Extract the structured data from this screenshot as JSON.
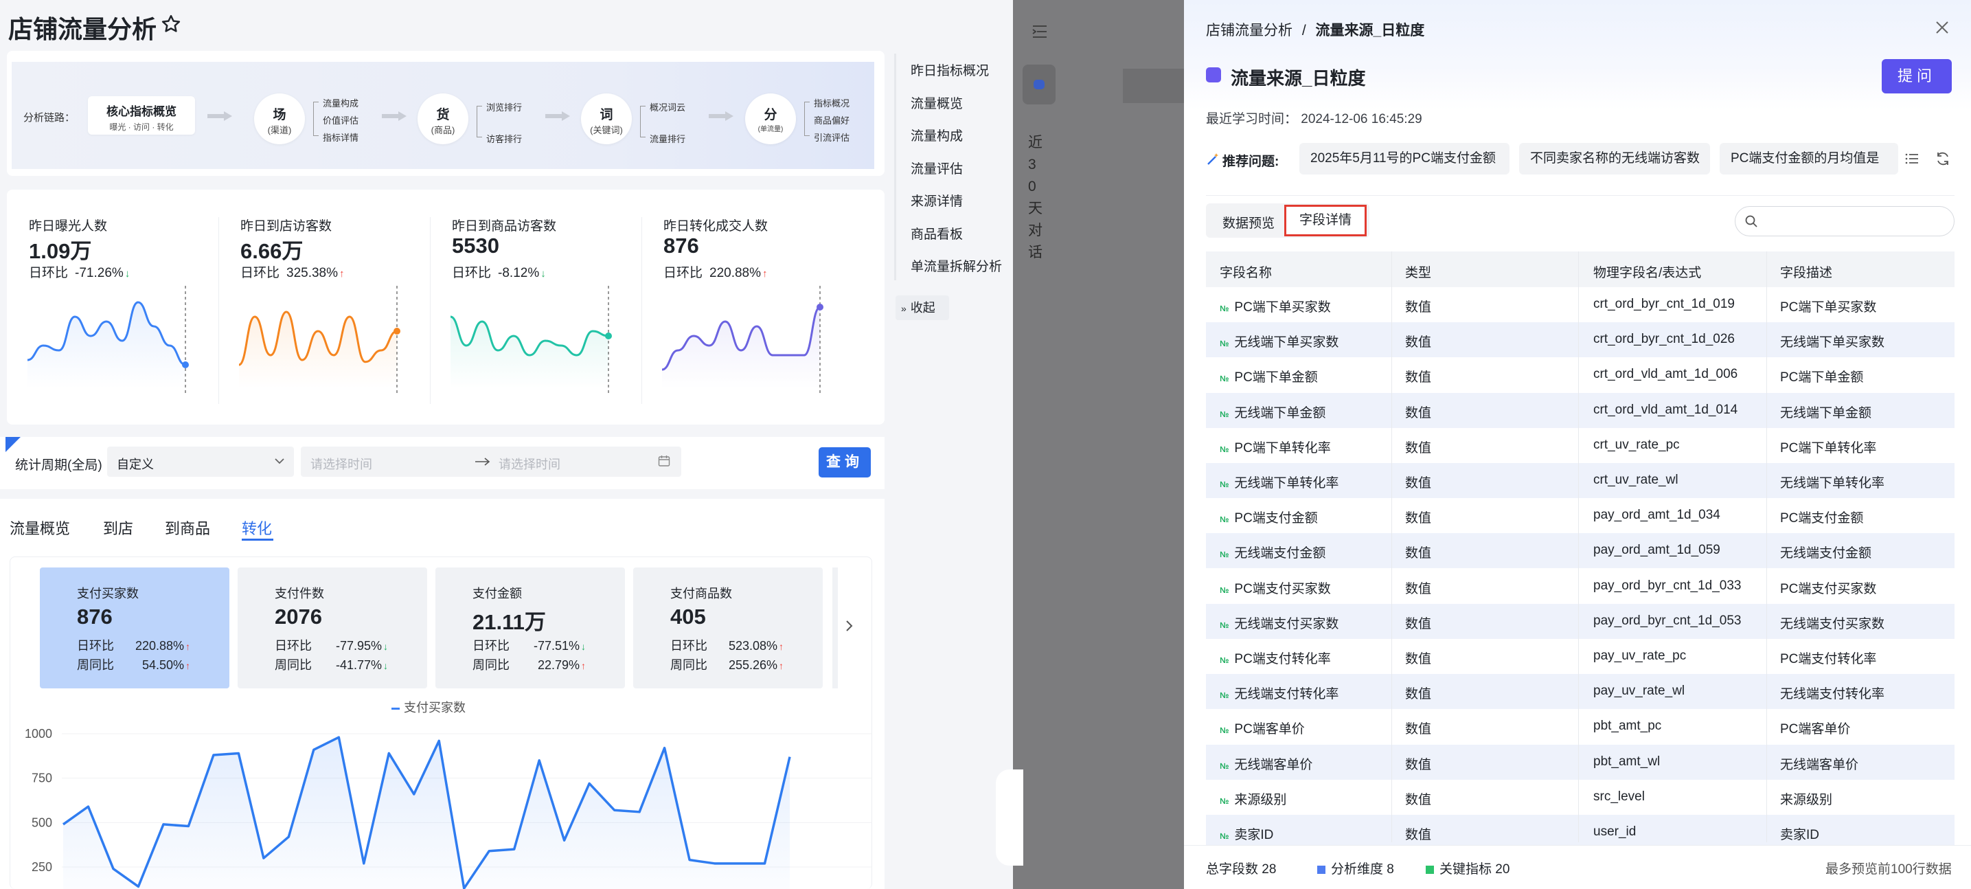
{
  "page": {
    "title": "店铺流量分析",
    "star_icon": "star-outline-icon"
  },
  "chain": {
    "label": "分析链路：",
    "core": {
      "title": "核心指标概览",
      "sub": "曝光 · 访问 · 转化"
    },
    "nodes": [
      {
        "big": "场",
        "small": "(渠道)",
        "subs": [
          "流量构成",
          "价值评估",
          "指标详情"
        ]
      },
      {
        "big": "货",
        "small": "(商品)",
        "subs": [
          "浏览排行",
          "访客排行"
        ]
      },
      {
        "big": "词",
        "small": "(关键词)",
        "subs": [
          "概况词云",
          "流量排行"
        ]
      },
      {
        "big": "分",
        "small": "(单流量)",
        "subs": [
          "指标概况",
          "商品偏好",
          "引流评估"
        ]
      }
    ]
  },
  "metrics": [
    {
      "title": "昨日曝光人数",
      "value": "1.09万",
      "cmp_label": "日环比",
      "cmp": "-71.26%",
      "dir": "down",
      "color": "#3b82f6",
      "series": [
        0.3,
        0.45,
        0.4,
        0.75,
        0.55,
        0.7,
        0.5,
        0.9,
        0.65,
        0.45,
        0.25
      ]
    },
    {
      "title": "昨日到店访客数",
      "value": "6.66万",
      "cmp_label": "日环比",
      "cmp": "325.38%",
      "dir": "up",
      "color": "#f5851f",
      "series": [
        0.25,
        0.75,
        0.35,
        0.8,
        0.3,
        0.6,
        0.35,
        0.75,
        0.28,
        0.4,
        0.6
      ]
    },
    {
      "title": "昨日到商品访客数",
      "value": "5530",
      "cmp_label": "日环比",
      "cmp": "-8.12%",
      "dir": "down",
      "color": "#22c3a6",
      "series": [
        0.75,
        0.45,
        0.7,
        0.4,
        0.55,
        0.35,
        0.5,
        0.45,
        0.35,
        0.6,
        0.55
      ]
    },
    {
      "title": "昨日转化成交人数",
      "value": "876",
      "cmp_label": "日环比",
      "cmp": "220.88%",
      "dir": "up",
      "color": "#6b63e0",
      "series": [
        0.2,
        0.4,
        0.55,
        0.45,
        0.7,
        0.4,
        0.65,
        0.35,
        0.35,
        0.35,
        0.85
      ]
    }
  ],
  "filter": {
    "label": "统计周期(全局)",
    "select_value": "自定义",
    "start_placeholder": "请选择时间",
    "end_placeholder": "请选择时间",
    "query_label": "查询"
  },
  "tabs": [
    "流量概览",
    "到店",
    "到商品",
    "转化"
  ],
  "active_tab": 3,
  "kpis": [
    {
      "title": "支付买家数",
      "value": "876",
      "d_label": "日环比",
      "d": "220.88%",
      "d_dir": "up",
      "w_label": "周同比",
      "w": "54.50%",
      "w_dir": "up"
    },
    {
      "title": "支付件数",
      "value": "2076",
      "d_label": "日环比",
      "d": "-77.95%",
      "d_dir": "down",
      "w_label": "周同比",
      "w": "-41.77%",
      "w_dir": "down"
    },
    {
      "title": "支付金额",
      "value": "21.11万",
      "d_label": "日环比",
      "d": "-77.51%",
      "d_dir": "down",
      "w_label": "周同比",
      "w": "22.79%",
      "w_dir": "up"
    },
    {
      "title": "支付商品数",
      "value": "405",
      "d_label": "日环比",
      "d": "523.08%",
      "d_dir": "up",
      "w_label": "周同比",
      "w": "255.26%",
      "w_dir": "up"
    }
  ],
  "chart_data": {
    "type": "area",
    "legend": "支付买家数",
    "y_ticks": [
      "1000",
      "750",
      "500",
      "250"
    ],
    "ylim": [
      130,
      1000
    ],
    "series": [
      {
        "name": "支付买家数",
        "values": [
          490,
          590,
          240,
          140,
          490,
          480,
          880,
          890,
          300,
          420,
          910,
          980,
          270,
          890,
          660,
          960,
          130,
          340,
          350,
          850,
          400,
          720,
          570,
          560,
          920,
          290,
          270,
          270,
          270,
          870
        ]
      }
    ]
  },
  "sidenav": {
    "items": [
      "昨日指标概况",
      "流量概览",
      "流量构成",
      "流量评估",
      "来源详情",
      "商品看板",
      "单流量拆解分析"
    ],
    "collapse_label": "收起"
  },
  "overlay": {
    "vertical_text": "近30天对话"
  },
  "drawer": {
    "breadcrumb_parent": "店铺流量分析",
    "breadcrumb_sep": "/",
    "breadcrumb_current": "流量来源_日粒度",
    "title": "流量来源_日粒度",
    "ask_label": "提问",
    "learn_time": "最近学习时间：   2024-12-06 16:45:29",
    "rec_label": "推荐问题:",
    "chips": [
      "2025年5月11号的PC端支付金额",
      "不同卖家名称的无线端访客数",
      "PC端支付金额的月均值是"
    ],
    "seg": [
      "数据预览",
      "字段详情"
    ],
    "columns": [
      "字段名称",
      "类型",
      "物理字段名/表达式",
      "字段描述"
    ],
    "rows": [
      [
        "PC端下单买家数",
        "数值",
        "crt_ord_byr_cnt_1d_019",
        "PC端下单买家数"
      ],
      [
        "无线端下单买家数",
        "数值",
        "crt_ord_byr_cnt_1d_026",
        "无线端下单买家数"
      ],
      [
        "PC端下单金额",
        "数值",
        "crt_ord_vld_amt_1d_006",
        "PC端下单金额"
      ],
      [
        "无线端下单金额",
        "数值",
        "crt_ord_vld_amt_1d_014",
        "无线端下单金额"
      ],
      [
        "PC端下单转化率",
        "数值",
        "crt_uv_rate_pc",
        "PC端下单转化率"
      ],
      [
        "无线端下单转化率",
        "数值",
        "crt_uv_rate_wl",
        "无线端下单转化率"
      ],
      [
        "PC端支付金额",
        "数值",
        "pay_ord_amt_1d_034",
        "PC端支付金额"
      ],
      [
        "无线端支付金额",
        "数值",
        "pay_ord_amt_1d_059",
        "无线端支付金额"
      ],
      [
        "PC端支付买家数",
        "数值",
        "pay_ord_byr_cnt_1d_033",
        "PC端支付买家数"
      ],
      [
        "无线端支付买家数",
        "数值",
        "pay_ord_byr_cnt_1d_053",
        "无线端支付买家数"
      ],
      [
        "PC端支付转化率",
        "数值",
        "pay_uv_rate_pc",
        "PC端支付转化率"
      ],
      [
        "无线端支付转化率",
        "数值",
        "pay_uv_rate_wl",
        "无线端支付转化率"
      ],
      [
        "PC端客单价",
        "数值",
        "pbt_amt_pc",
        "PC端客单价"
      ],
      [
        "无线端客单价",
        "数值",
        "pbt_amt_wl",
        "无线端客单价"
      ],
      [
        "来源级别",
        "数值",
        "src_level",
        "来源级别"
      ],
      [
        "卖家ID",
        "数值",
        "user_id",
        "卖家ID"
      ]
    ],
    "footer": {
      "total": "总字段数 28",
      "dims": "分析维度 8",
      "key": "关键指标 20",
      "note": "最多预览前100行数据",
      "dim_color": "#4f7cf0",
      "key_color": "#2cc36b"
    }
  }
}
